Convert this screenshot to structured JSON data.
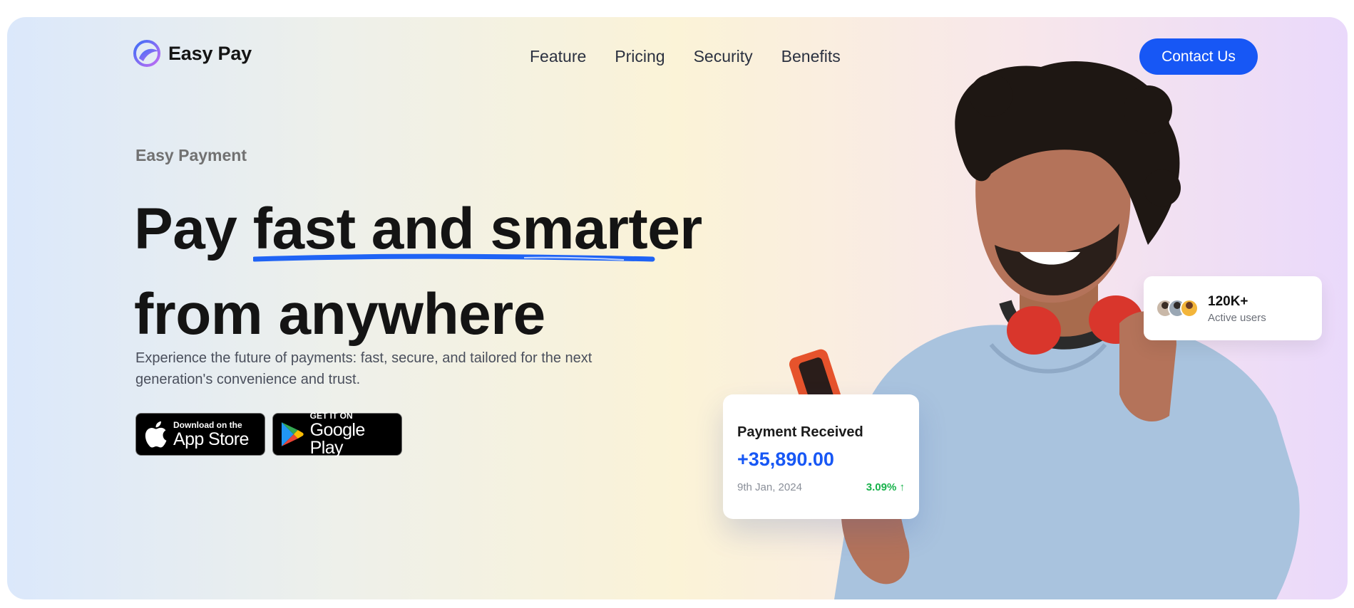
{
  "brand": {
    "name": "Easy Pay"
  },
  "nav": {
    "items": [
      "Feature",
      "Pricing",
      "Security",
      "Benefits"
    ]
  },
  "header": {
    "cta_label": "Contact Us"
  },
  "hero": {
    "eyebrow": "Easy Payment",
    "headline_lead": "Pay ",
    "headline_highlight": "fast and smarter",
    "headline_line2": "from anywhere",
    "description": "Experience the future of payments: fast, secure, and tailored for the next generation's convenience and trust."
  },
  "store_buttons": {
    "apple": {
      "small": "Download on the",
      "big": "App Store"
    },
    "google": {
      "small": "GET IT ON",
      "big": "Google Play"
    }
  },
  "payment_card": {
    "title": "Payment Received",
    "amount": "+35,890.00",
    "date": "9th Jan, 2024",
    "change": "3.09% ↑"
  },
  "users_card": {
    "count": "120K+",
    "label": "Active users"
  },
  "colors": {
    "accent": "#1757f5",
    "positive": "#18b24b",
    "gradient": [
      "#dbe8fb",
      "#fbf3d7",
      "#ead9fb"
    ]
  }
}
